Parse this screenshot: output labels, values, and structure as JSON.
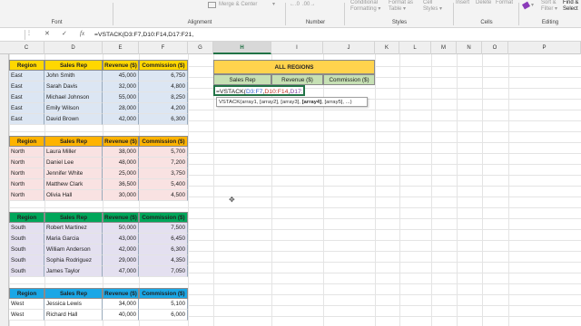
{
  "ribbon": {
    "groups": [
      {
        "label": "Font"
      },
      {
        "label": "Alignment"
      },
      {
        "label": "Number"
      },
      {
        "label": "Styles"
      },
      {
        "label": "Cells"
      },
      {
        "label": "Editing"
      }
    ],
    "merge_center": "Merge & Center",
    "conditional_formatting": [
      "Conditional",
      "Formatting"
    ],
    "format_as_table": [
      "Format as",
      "Table"
    ],
    "cell_styles": [
      "Cell",
      "Styles"
    ],
    "insert": "Insert",
    "delete": "Delete",
    "format": "Format",
    "sort_filter": [
      "Sort &",
      "Filter"
    ],
    "find_select": [
      "Find &",
      "Select"
    ]
  },
  "formula_bar": {
    "cancel": "✕",
    "enter": "✓",
    "fx": "fx",
    "formula": "=VSTACK(D3:F7,D10:F14,D17:F21,"
  },
  "columns": [
    "C",
    "D",
    "E",
    "F",
    "G",
    "H",
    "I",
    "J",
    "K",
    "L",
    "M",
    "N",
    "O",
    "P"
  ],
  "tables": [
    {
      "headers": [
        "Region",
        "Sales Rep",
        "Revenue ($)",
        "Commission ($)"
      ],
      "header_color": "#ffd700",
      "body_color": "#dce6f3",
      "rows": [
        [
          "East",
          "John Smith",
          "45,000",
          "6,750"
        ],
        [
          "East",
          "Sarah Davis",
          "32,000",
          "4,800"
        ],
        [
          "East",
          "Michael Johnson",
          "55,000",
          "8,250"
        ],
        [
          "East",
          "Emily Wilson",
          "28,000",
          "4,200"
        ],
        [
          "East",
          "David Brown",
          "42,000",
          "6,300"
        ]
      ]
    },
    {
      "headers": [
        "Region",
        "Sales Rep",
        "Revenue ($)",
        "Commission ($)"
      ],
      "header_color": "#ffb300",
      "body_color": "#f9e2e2",
      "rows": [
        [
          "North",
          "Laura Miller",
          "38,000",
          "5,700"
        ],
        [
          "North",
          "Daniel Lee",
          "48,000",
          "7,200"
        ],
        [
          "North",
          "Jennifer White",
          "25,000",
          "3,750"
        ],
        [
          "North",
          "Matthew Clark",
          "36,500",
          "5,400"
        ],
        [
          "North",
          "Olivia Hall",
          "30,000",
          "4,500"
        ]
      ]
    },
    {
      "headers": [
        "Region",
        "Sales Rep",
        "Revenue ($)",
        "Commission ($)"
      ],
      "header_color": "#00a65a",
      "body_color": "#e4e0f0",
      "rows": [
        [
          "South",
          "Robert Martinez",
          "50,000",
          "7,500"
        ],
        [
          "South",
          "Maria Garcia",
          "43,000",
          "6,450"
        ],
        [
          "South",
          "William Anderson",
          "42,000",
          "6,300"
        ],
        [
          "South",
          "Sophia Rodriguez",
          "29,000",
          "4,350"
        ],
        [
          "South",
          "James Taylor",
          "47,000",
          "7,050"
        ]
      ]
    },
    {
      "headers": [
        "Region",
        "Sales Rep",
        "Revenue ($)",
        "Commission ($)"
      ],
      "header_color": "#1aa7e6",
      "body_color": "#ffffff",
      "rows": [
        [
          "West",
          "Jessica Lewis",
          "34,000",
          "5,100"
        ],
        [
          "West",
          "Richard Hall",
          "40,000",
          "6,000"
        ]
      ]
    }
  ],
  "all_regions": {
    "title": "ALL REGIONS",
    "title_color": "#ffd34d",
    "headers": [
      "Sales Rep",
      "Revenue ($)",
      "Commission ($)"
    ],
    "header_color": "#c6e0b4",
    "editing_formula_black": "=VSTACK(",
    "editing_formula_parts": [
      {
        "text": "D3:F7",
        "color": "#2f5fd0"
      },
      {
        "text": ",",
        "color": "#222222"
      },
      {
        "text": "D10:F14",
        "color": "#c0392b"
      },
      {
        "text": ",",
        "color": "#222222"
      },
      {
        "text": "D17:F21",
        "color": "#7b3fa0"
      },
      {
        "text": ",",
        "color": "#222222"
      }
    ],
    "tooltip": {
      "pre": "VSTACK(array1, [array2], [array3], ",
      "bold": "[array4]",
      "post": ", [array5], ...)"
    }
  }
}
